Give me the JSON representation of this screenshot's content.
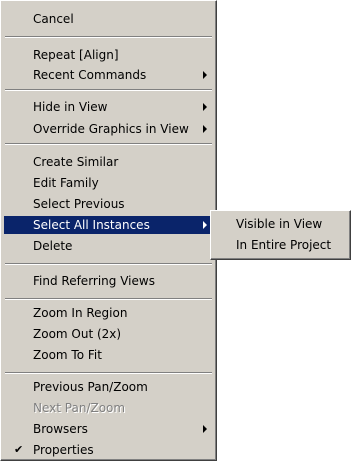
{
  "context_menu": {
    "items": [
      {
        "label": "Cancel"
      },
      {
        "label": "Repeat [Align]"
      },
      {
        "label": "Recent Commands"
      },
      {
        "label": "Hide in View"
      },
      {
        "label": "Override Graphics in View"
      },
      {
        "label": "Create Similar"
      },
      {
        "label": "Edit Family"
      },
      {
        "label": "Select Previous"
      },
      {
        "label": "Select All Instances"
      },
      {
        "label": "Delete"
      },
      {
        "label": "Find Referring Views"
      },
      {
        "label": "Zoom In Region"
      },
      {
        "label": "Zoom Out (2x)"
      },
      {
        "label": "Zoom To Fit"
      },
      {
        "label": "Previous Pan/Zoom"
      },
      {
        "label": "Next Pan/Zoom"
      },
      {
        "label": "Browsers"
      },
      {
        "label": "Properties",
        "checked": true
      }
    ],
    "highlighted": "Select All Instances",
    "disabled": [
      "Next Pan/Zoom"
    ]
  },
  "submenu": {
    "items": [
      {
        "label": "Visible in View"
      },
      {
        "label": "In Entire Project"
      }
    ]
  },
  "colors": {
    "menu_background": "#d4d0c8",
    "highlight": "#0a246a",
    "disabled_text": "#808080"
  },
  "icons": {
    "submenu_arrow": "triangle-right",
    "checkmark": "✔"
  }
}
